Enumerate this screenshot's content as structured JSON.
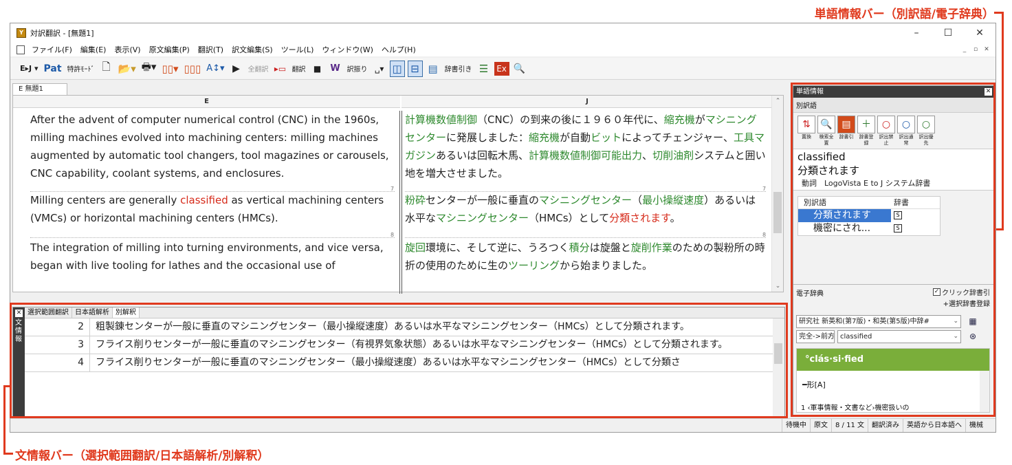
{
  "callouts": {
    "word_info_bar": "単語情報バー（別訳語/電子辞典）",
    "sentence_info_bar": "文情報バー（選択範囲翻訳/日本語解析/別解釈）"
  },
  "window": {
    "title": "対訳翻訳 - [無題1]",
    "controls": {
      "minimize": "–",
      "maximize": "☐",
      "close": "✕"
    }
  },
  "menu": [
    "ファイル(F)",
    "編集(E)",
    "表示(V)",
    "原文編集(P)",
    "翻訳(T)",
    "訳文編集(S)",
    "ツール(L)",
    "ウィンドウ(W)",
    "ヘルプ(H)"
  ],
  "toolbar": {
    "ej": "E▸J ▾",
    "pat": "Pat",
    "patent_mode": "特許ﾓｰﾄﾞ",
    "translate_all": "全翻訳",
    "translate": "翻訳",
    "furigana": "訳振り",
    "dict_lookup": "辞書引き"
  },
  "document": {
    "tab_label": "E  無題1",
    "col_e": "E",
    "col_j": "J",
    "english": [
      {
        "pre": "After the advent of computer numerical control (CNC) in the 1960s, milling machines evolved into machining centers: milling machines augmented by automatic tool changers, tool magazines or carousels, CNC capability, coolant systems, and enclosures.",
        "hl": "",
        "post": ""
      },
      {
        "pre": "Milling centers are generally ",
        "hl": "classified",
        "post": " as vertical machining centers (VMCs) or horizontal machining centers (HMCs)."
      },
      {
        "pre": "The integration of milling into turning environments, and vice versa, began with live tooling for lathes and the occasional use of",
        "hl": "",
        "post": ""
      }
    ],
    "para_nums": [
      "7",
      "8"
    ]
  },
  "japanese": {
    "p1": [
      {
        "t": "計算機数値制御",
        "c": "g"
      },
      {
        "t": "（CNC）の到来の後に１９６０年代に、",
        "c": ""
      },
      {
        "t": "縮充機",
        "c": "g"
      },
      {
        "t": "が",
        "c": ""
      },
      {
        "t": "マシニングセンター",
        "c": "g"
      },
      {
        "t": "に発展しました：",
        "c": ""
      },
      {
        "t": "縮充機",
        "c": "g"
      },
      {
        "t": "が自動",
        "c": ""
      },
      {
        "t": "ビット",
        "c": "g"
      },
      {
        "t": "によってチェンジャー、",
        "c": ""
      },
      {
        "t": "工具マガジン",
        "c": "g"
      },
      {
        "t": "あるいは回転木馬、",
        "c": ""
      },
      {
        "t": "計算機数値制御可能出力",
        "c": "g"
      },
      {
        "t": "、",
        "c": ""
      },
      {
        "t": "切削油剤",
        "c": "g"
      },
      {
        "t": "システムと囲い地を増大させました。",
        "c": ""
      }
    ],
    "p2": [
      {
        "t": "粉砕",
        "c": "g"
      },
      {
        "t": "センターが一般に垂直の",
        "c": ""
      },
      {
        "t": "マシニングセンター",
        "c": "g"
      },
      {
        "t": "（",
        "c": ""
      },
      {
        "t": "最小操縦速度",
        "c": "g"
      },
      {
        "t": "）あるいは水平な",
        "c": ""
      },
      {
        "t": "マシニングセンター",
        "c": "g"
      },
      {
        "t": "（HMCs）として",
        "c": ""
      },
      {
        "t": "分類されます",
        "c": "r"
      },
      {
        "t": "。",
        "c": ""
      }
    ],
    "p3": [
      {
        "t": "旋回",
        "c": "g"
      },
      {
        "t": "環境に、そして逆に、うろつく",
        "c": ""
      },
      {
        "t": "積分",
        "c": "g"
      },
      {
        "t": "は旋盤と",
        "c": ""
      },
      {
        "t": "旋削作業",
        "c": "g"
      },
      {
        "t": "のための製粉所の時折の使用のために生の",
        "c": ""
      },
      {
        "t": "ツーリング",
        "c": "g"
      },
      {
        "t": "から始まりました。",
        "c": ""
      }
    ]
  },
  "word_panel": {
    "title": "単語情報",
    "alt_section": "別訳語",
    "icon_labels": [
      "置換",
      "検索全置",
      "辞書引",
      "辞書登録",
      "訳出禁止",
      "訳出通常",
      "訳出優先"
    ],
    "word": "classified",
    "translation": "分類されます",
    "dict_line": "動詞　LogoVista E to J システム辞書",
    "table_headers": [
      "別訳語",
      "辞書"
    ],
    "alternatives": [
      {
        "word": "分類されます",
        "dict": "S",
        "selected": true
      },
      {
        "word": "機密にされ...",
        "dict": "S",
        "selected": false
      }
    ]
  },
  "edict": {
    "title": "電子辞典",
    "click_lookup": "クリック辞書引",
    "click_checked": "✓",
    "select_dict_reg": "+選択辞書登録",
    "dict_select": "研究社 新英和(第7版)・和英(第5版)中辞#",
    "match_mode": "完全->前方",
    "search_term": "classified",
    "headword": "°clás·si·fied",
    "pos": "━形[A]",
    "definition": "1 ‹軍事情報・文書など›機密扱いの",
    "example_badge": "用例"
  },
  "sentence_panel": {
    "side_label": "文情報",
    "tabs": [
      "選択範囲翻訳",
      "日本語解析",
      "別解釈"
    ],
    "active_tab": "別解釈",
    "rows": [
      {
        "n": "2",
        "text": "粗製錬センターが一般に垂直のマシニングセンター（最小操縦速度）あるいは水平なマシニングセンター（HMCs）として分類されます。"
      },
      {
        "n": "3",
        "text": "フライス削りセンターが一般に垂直のマシニングセンター（有視界気象状態）あるいは水平なマシニングセンター（HMCs）として分類されます。"
      },
      {
        "n": "4",
        "text": "フライス削りセンターが一般に垂直のマシニングセンター（最小操縦速度）あるいは水平なマシニングセンター（HMCs）として分類さ"
      }
    ]
  },
  "status": [
    "待機中",
    "原文",
    "8 / 11 文",
    "翻訳済み",
    "英語から日本語へ",
    "機械"
  ],
  "colors": {
    "annotation": "#e03a1e",
    "term_green": "#2f8a2f",
    "highlight_red": "#d62a1a",
    "selection_blue": "#3a78d0",
    "headword_green": "#7aae3a"
  }
}
